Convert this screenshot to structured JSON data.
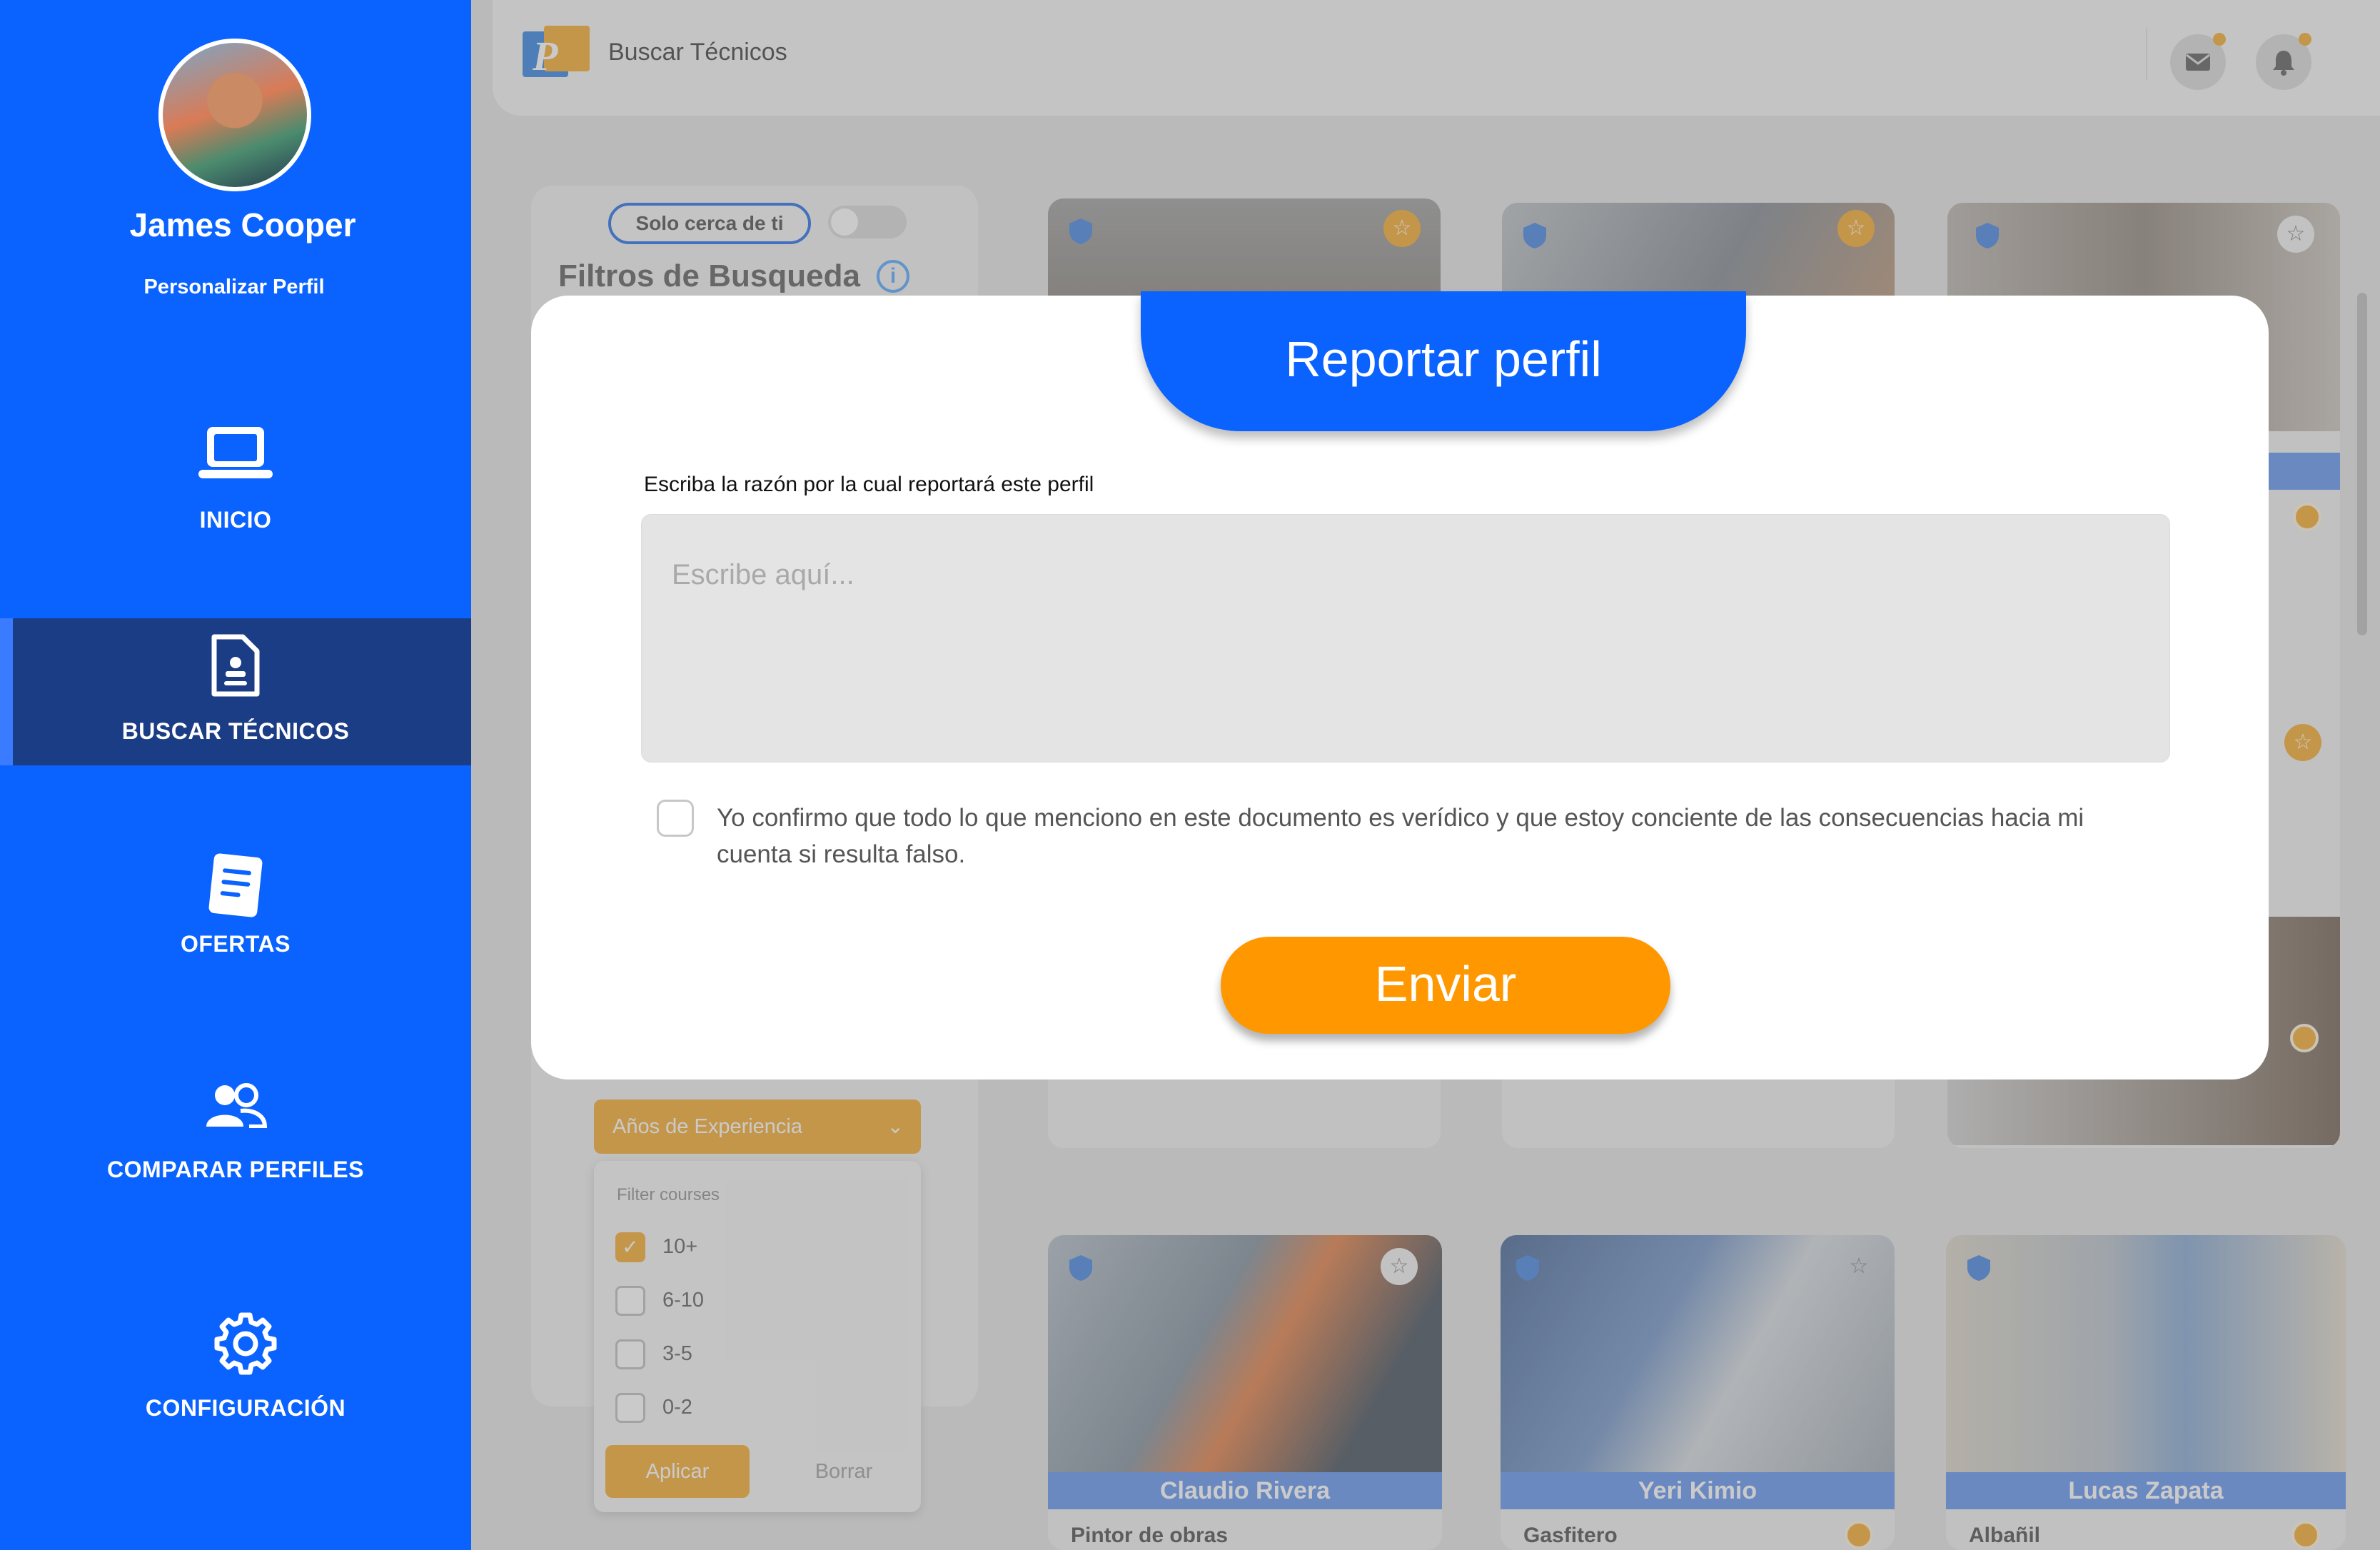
{
  "sidebar": {
    "user_name": "James Cooper",
    "customize_label": "Personalizar Perfil",
    "items": [
      {
        "label": "INICIO",
        "icon": "laptop-icon"
      },
      {
        "label": "BUSCAR TÉCNICOS",
        "icon": "document-icon",
        "active": true
      },
      {
        "label": "OFERTAS",
        "icon": "offers-icon"
      },
      {
        "label": "COMPARAR PERFILES",
        "icon": "users-icon"
      },
      {
        "label": "CONFIGURACIÓN",
        "icon": "gear-icon"
      }
    ]
  },
  "header": {
    "title": "Buscar Técnicos",
    "icons": [
      "mail-icon",
      "bell-icon"
    ]
  },
  "filters": {
    "near_label": "Solo cerca de ti",
    "title": "Filtros de Busqueda",
    "experience": {
      "label": "Años de Experiencia",
      "menu_title": "Filter courses",
      "options": [
        {
          "label": "10+",
          "checked": true
        },
        {
          "label": "6-10",
          "checked": false
        },
        {
          "label": "3-5",
          "checked": false
        },
        {
          "label": "0-2",
          "checked": false
        }
      ],
      "apply_label": "Aplicar",
      "clear_label": "Borrar"
    }
  },
  "cards": [
    {
      "name": "Claudio Rivera",
      "role": "Pintor de obras"
    },
    {
      "name": "Yeri Kimio",
      "role": "Gasfitero"
    },
    {
      "name": "Lucas Zapata",
      "role": "Albañil"
    }
  ],
  "modal": {
    "title": "Reportar perfil",
    "reason_label": "Escriba la razón por la cual reportará este perfil",
    "reason_placeholder": "Escribe aquí...",
    "confirm_text": "Yo confirmo que todo lo que menciono en este documento es verídico y que estoy conciente de las consecuencias hacia mi cuenta si resulta falso.",
    "send_label": "Enviar"
  },
  "colors": {
    "primary": "#0a63ff",
    "accent": "#ff9800",
    "sidebar_active": "#1b3d86"
  }
}
